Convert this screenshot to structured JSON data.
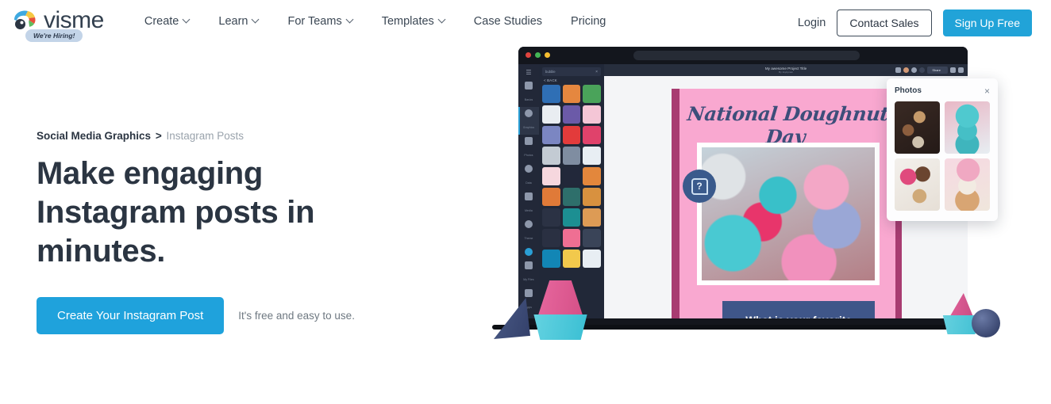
{
  "header": {
    "logo_word": "visme",
    "logo_mark_icon": "visme-fan-logo-icon",
    "hiring_badge": "We're Hiring!",
    "nav": [
      {
        "label": "Create",
        "has_chevron": true,
        "icon": "chevron-down-icon"
      },
      {
        "label": "Learn",
        "has_chevron": true,
        "icon": "chevron-down-icon"
      },
      {
        "label": "For Teams",
        "has_chevron": true,
        "icon": "chevron-down-icon"
      },
      {
        "label": "Templates",
        "has_chevron": true,
        "icon": "chevron-down-icon"
      },
      {
        "label": "Case Studies",
        "has_chevron": false,
        "icon": ""
      },
      {
        "label": "Pricing",
        "has_chevron": false,
        "icon": ""
      }
    ],
    "login_label": "Login",
    "contact_sales_label": "Contact Sales",
    "sign_up_label": "Sign Up Free"
  },
  "hero": {
    "breadcrumb": {
      "parent": "Social Media Graphics",
      "separator": ">",
      "current": "Instagram Posts"
    },
    "headline": "Make engaging Instagram posts in minutes.",
    "cta_label": "Create Your Instagram Post",
    "cta_note": "It's free and easy to use."
  },
  "illustration": {
    "browser": {
      "traffic_lights": [
        "red",
        "green",
        "yellow"
      ],
      "url_bar_value": ""
    },
    "editor": {
      "hamburger_icon": "hamburger-menu-icon",
      "rail_items": [
        {
          "label": "Basics",
          "icon": "basics-icon",
          "active": false
        },
        {
          "label": "Graphics",
          "icon": "graphics-icon",
          "active": true
        },
        {
          "label": "Photos",
          "icon": "photos-icon",
          "active": false
        },
        {
          "label": "Data",
          "icon": "data-icon",
          "active": false
        },
        {
          "label": "Media",
          "icon": "media-icon",
          "active": false
        },
        {
          "label": "Theme",
          "icon": "theme-icon",
          "active": false
        },
        {
          "label": "?",
          "icon": "help-icon",
          "active": false
        },
        {
          "label": "My Files",
          "icon": "my-files-icon",
          "active": false
        },
        {
          "label": "Apps",
          "icon": "apps-icon",
          "active": false
        }
      ],
      "graphics_panel": {
        "search_value": "bubble",
        "clear_icon": "close-icon",
        "back_label": "< BACK",
        "thumb_colors": [
          "#2f6fb5",
          "#e5873f",
          "#4aa35a",
          "#e9edf1",
          "#6b5aa8",
          "#f4c6d6",
          "#7b86c2",
          "#e33b3b",
          "#e0426b",
          "#c3cbd3",
          "#7f8da1",
          "#e8eef3",
          "#f6d7de",
          "#22283a",
          "#e3873c",
          "#e07a38",
          "#2e6f6b",
          "#d8913f",
          "#2b3244",
          "#1c8f92",
          "#dd9b55",
          "#2a3042",
          "#ef6f93",
          "#3a4458",
          "#1286b5",
          "#f2c94c",
          "#e8eef3"
        ]
      },
      "topbar": {
        "project_title": "My awesome Project Title",
        "project_byline": "By Jeykyman",
        "share_label": "Share",
        "icons": [
          "image-icon",
          "avatar-icon",
          "avatar-icon",
          "add-collaborator-icon",
          "present-icon",
          "download-icon"
        ]
      },
      "canvas_design": {
        "title": "National Doughnut Day",
        "caption": "What is your favorite",
        "help_badge_icon": "question-bubble-icon",
        "background_color": "#f9a8d0",
        "border_color": "#a83c71",
        "caption_color": "#3f5689"
      },
      "photos_panel": {
        "title": "Photos",
        "close_icon": "close-icon",
        "thumbnails": [
          "doughnuts-dark-photo",
          "teal-doughnut-stack-photo",
          "pink-doughnuts-photo",
          "glazed-doughnut-stack-photo"
        ]
      }
    },
    "decor": [
      {
        "name": "pink-cone",
        "color": "#d44f86"
      },
      {
        "name": "cyan-disc",
        "color": "#36bdd2"
      },
      {
        "name": "navy-cone",
        "color": "#33406a"
      },
      {
        "name": "navy-sphere",
        "color": "#3b4871"
      }
    ]
  },
  "colors": {
    "accent_blue": "#21a3b8",
    "primary_blue": "#1fa2dc",
    "headline_navy": "#2b3542",
    "muted_gray": "#9aa3ac"
  }
}
